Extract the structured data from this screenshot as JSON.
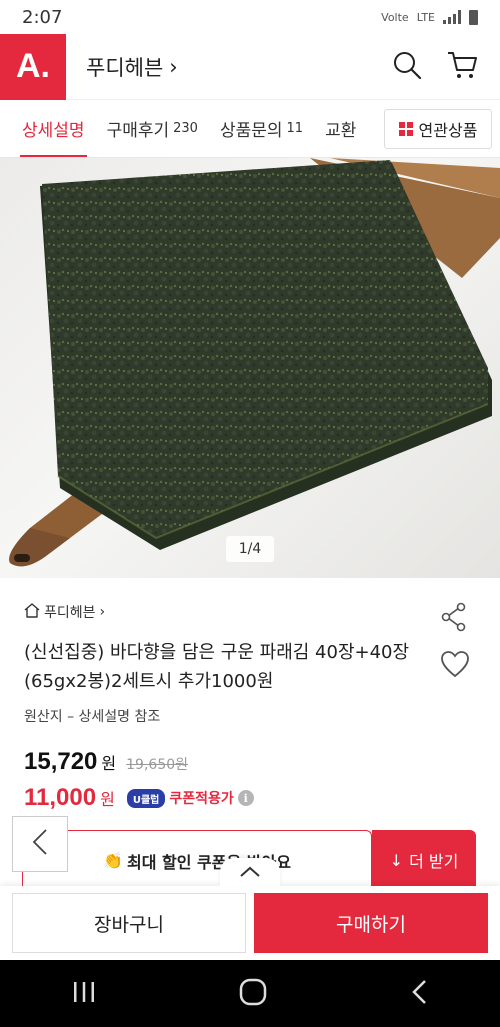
{
  "status_bar": {
    "time": "2:07",
    "carrier": "Volte",
    "network": "LTE"
  },
  "header": {
    "logo_text": "A.",
    "store_name": "푸디헤븐",
    "chevron": "›"
  },
  "tabs": [
    {
      "label": "상세설명",
      "count": ""
    },
    {
      "label": "구매후기",
      "count": "230"
    },
    {
      "label": "상품문의",
      "count": "11"
    },
    {
      "label": "교환",
      "count": ""
    }
  ],
  "related_button": {
    "label": "연관상품"
  },
  "image": {
    "counter": "1/4"
  },
  "product": {
    "seller": "푸디헤븐",
    "seller_chevron": "›",
    "title": "(신선집중) 바다향을 담은 구운 파래김 40장+40장(65gx2봉)2세트시 추가1000원",
    "origin": "원산지 – 상세설명 참조",
    "price": "15,720",
    "price_unit": "원",
    "original_price": "19,650원",
    "coupon_price": "11,000",
    "coupon_unit": "원",
    "coupon_badge": "U클럽",
    "coupon_label": "쿠폰적용가",
    "info_glyph": "i"
  },
  "coupon_banner": {
    "emoji": "👏",
    "text": "최대 할인 쿠폰을 받아요",
    "more_label": "더 받기",
    "more_icon": "↓"
  },
  "actions": {
    "cart_label": "장바구니",
    "buy_label": "구매하기"
  },
  "colors": {
    "brand": "#e4283d",
    "coupon_badge": "#2b3ea8",
    "nav_bar": "#000000"
  }
}
